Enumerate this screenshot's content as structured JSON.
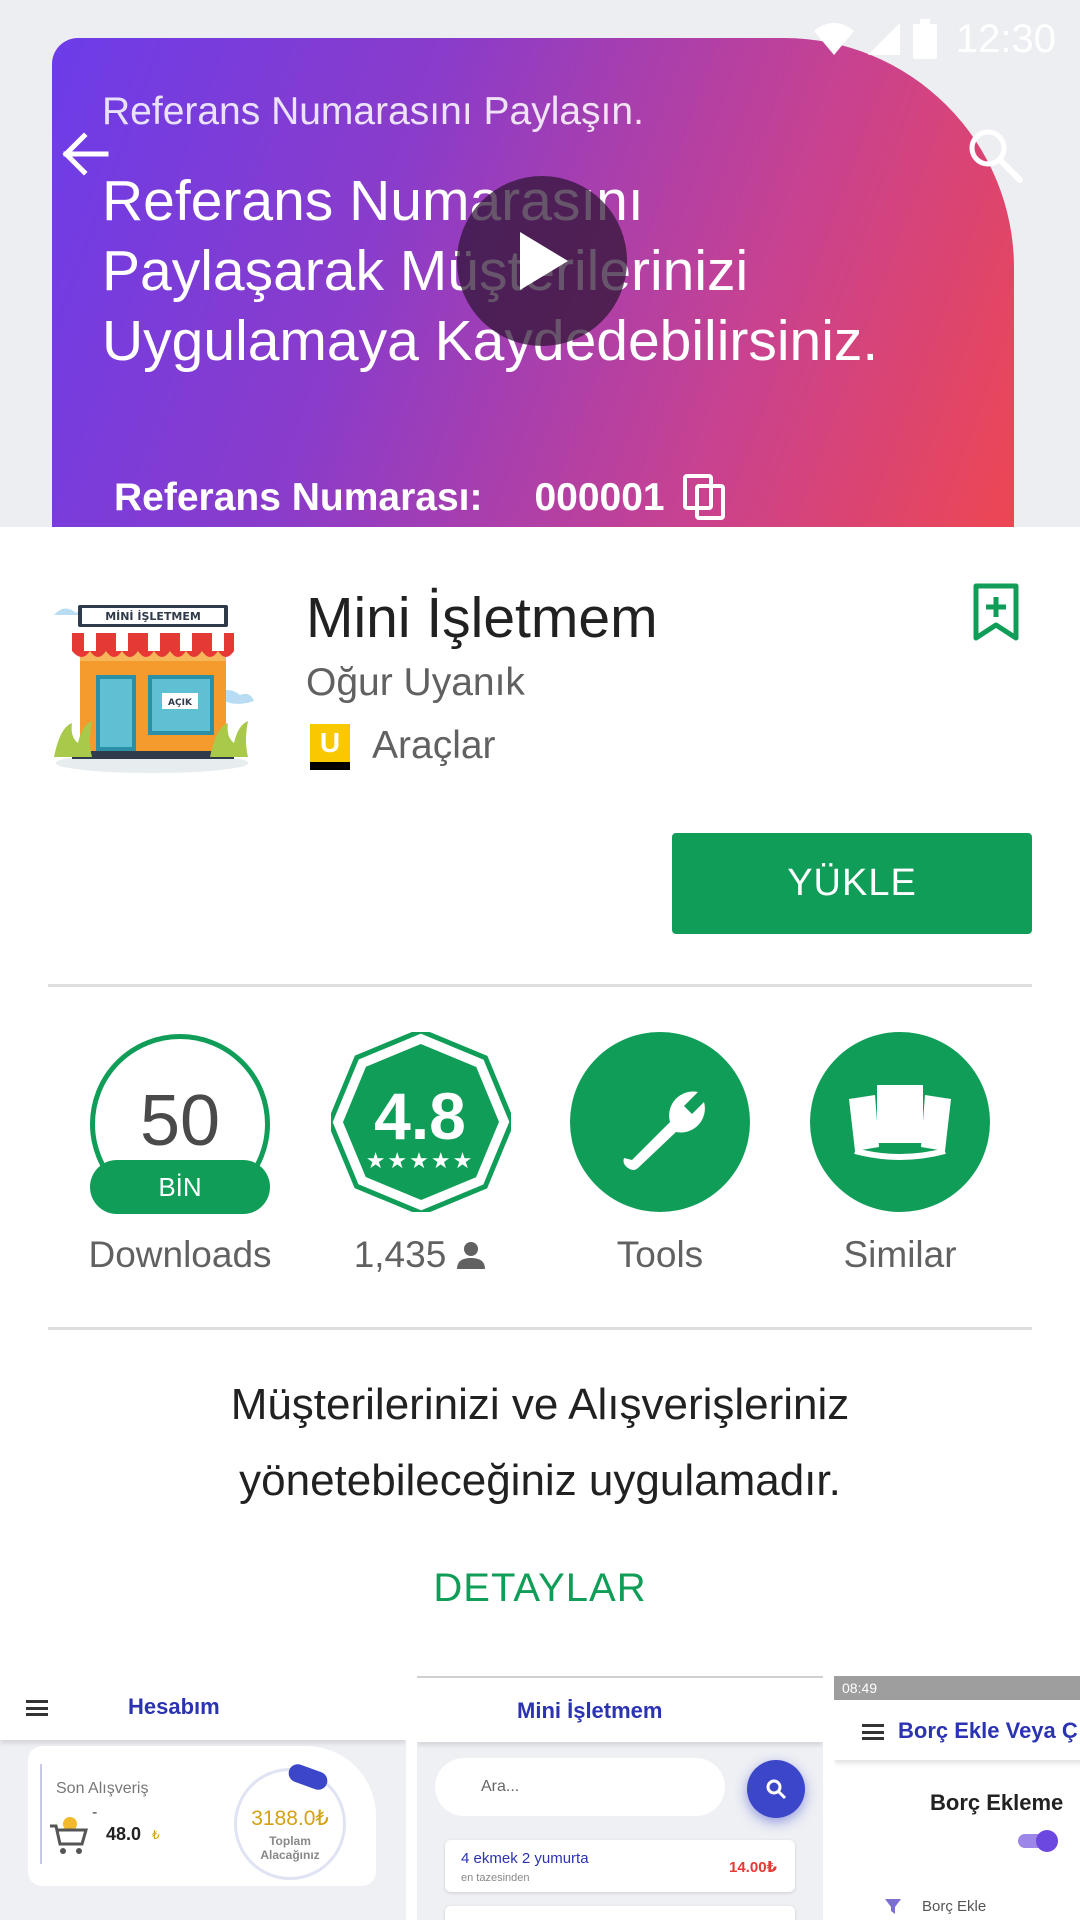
{
  "status_bar": {
    "time": "12:30"
  },
  "hero": {
    "subtitle": "Referans Numarasını Paylaşın.",
    "title_lines": [
      "Referans Numarasını",
      "Paylaşarak Müşterilerinizi",
      "Uygulamaya Kaydedebilirsiniz."
    ],
    "ref_label": "Referans Numarası:",
    "ref_value": "000001",
    "gradient": [
      "#6c3ce9",
      "#f0474e"
    ]
  },
  "app": {
    "name": "Mini İşletmem",
    "developer": "Oğur Uyanık",
    "content_rating": "U",
    "category": "Araçlar",
    "install_label": "YÜKLE",
    "icon_sign": "MİNİ İŞLETMEM",
    "icon_door_sign": "AÇIK",
    "accent_color": "#109d58"
  },
  "stats": {
    "downloads_number": "50",
    "downloads_unit": "BİN",
    "downloads_label": "Downloads",
    "rating": "4.8",
    "rating_stars": "★★★★★",
    "rating_count": "1,435",
    "tools_label": "Tools",
    "similar_label": "Similar"
  },
  "description": {
    "lines": [
      "Müşterilerinizi ve Alışverişleriniz",
      "yönetebileceğiniz uygulamadır."
    ],
    "details_label": "DETAYLAR"
  },
  "screenshots": {
    "shot1": {
      "title": "Hesabım",
      "card_label": "Son Alışveriş",
      "dash": "-",
      "last_amount": "48.0",
      "currency": "₺",
      "total": "3188.0₺",
      "total_label_1": "Toplam",
      "total_label_2": "Alacağınız"
    },
    "shot2": {
      "title": "Mini İşletmem",
      "search_placeholder": "Ara...",
      "item_name": "4 ekmek 2 yumurta",
      "item_sub": "en tazesinden",
      "item_price": "14.00₺"
    },
    "shot3": {
      "status_time": "08:49",
      "title": "Borç Ekle Veya Ç",
      "heading": "Borç Ekleme",
      "link": "Borç Ekle"
    }
  }
}
